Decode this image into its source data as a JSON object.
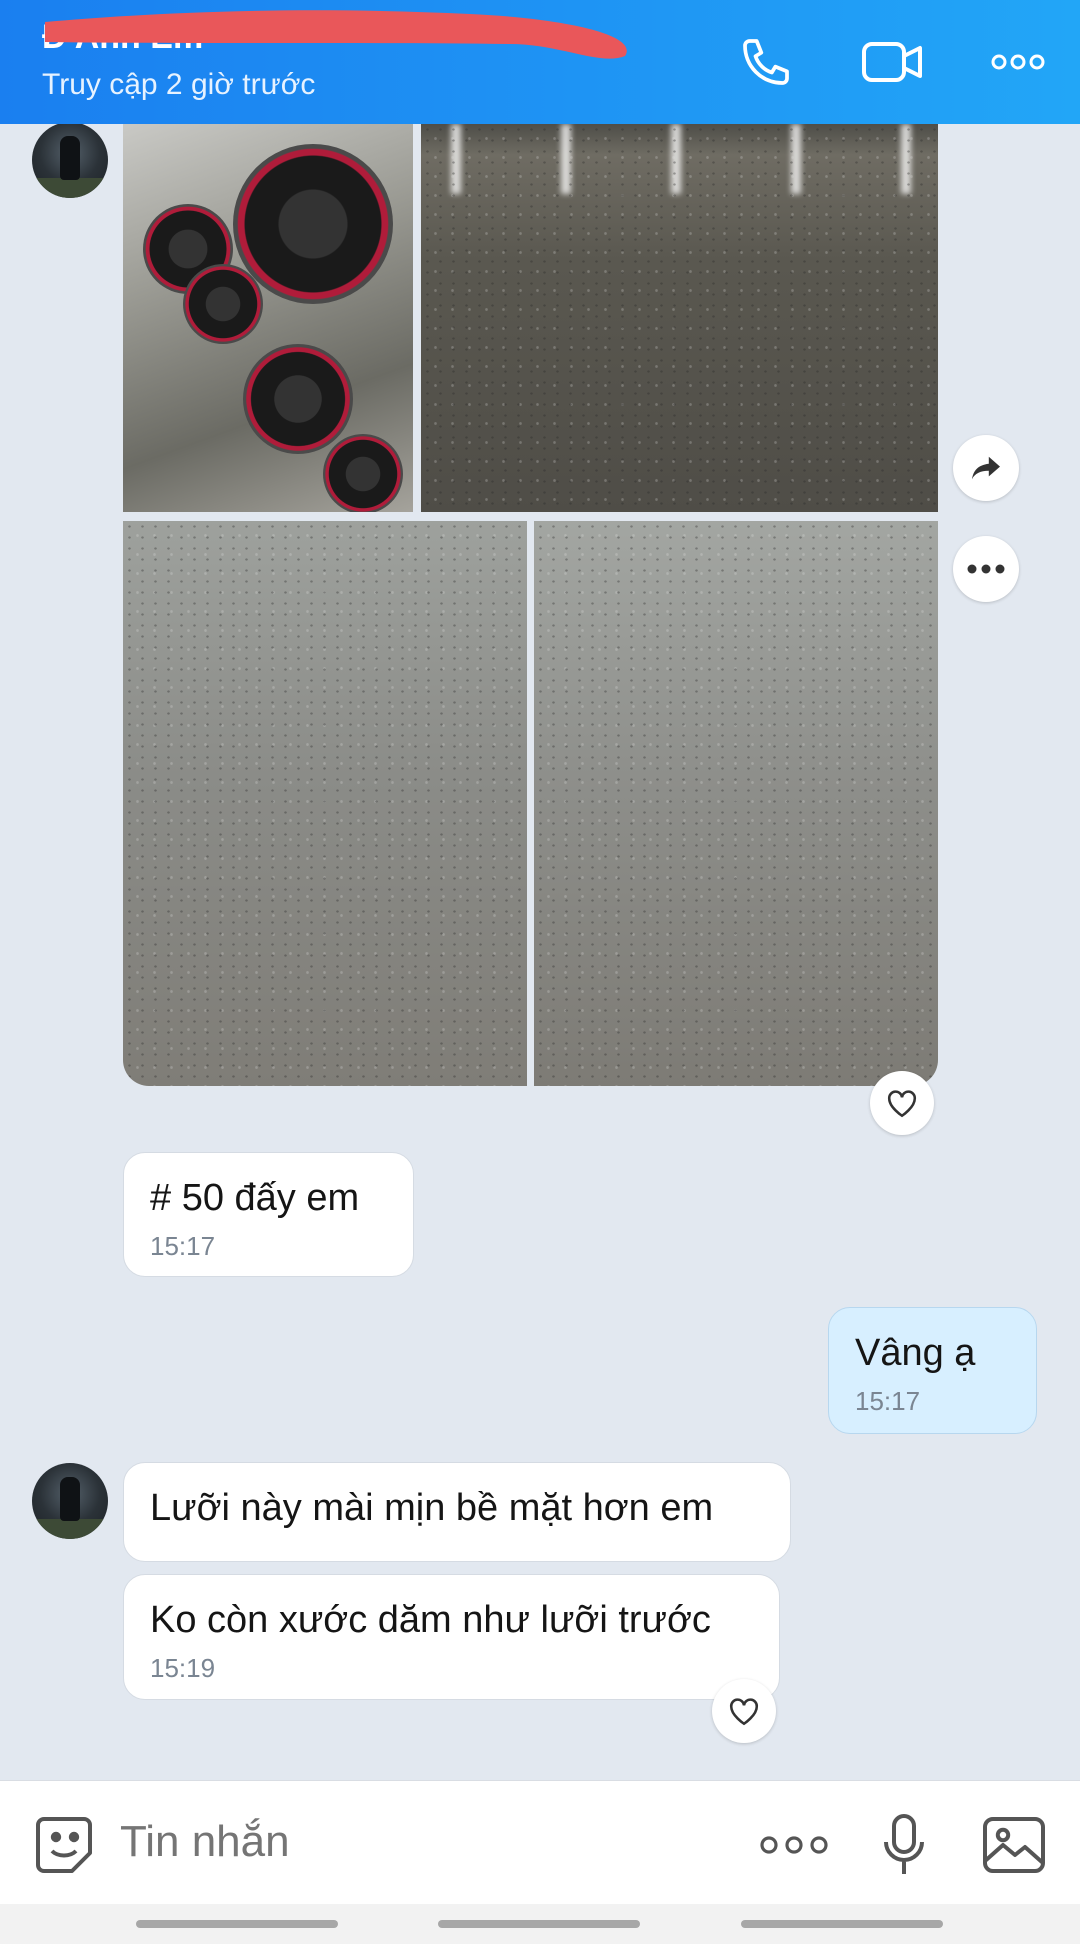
{
  "header": {
    "contact_name": "Đ Anh Em",
    "last_seen": "Truy cập 2 giờ trước",
    "icons": [
      "phone-icon",
      "video-call-icon",
      "more-icon"
    ]
  },
  "messages": [
    {
      "type": "album",
      "from": "contact",
      "photos": 4,
      "actions": [
        "share-icon",
        "more-icon",
        "heart-icon"
      ]
    },
    {
      "type": "text",
      "from": "contact",
      "text": "# 50 đấy em",
      "time": "15:17"
    },
    {
      "type": "text",
      "from": "me",
      "text": "Vâng ạ",
      "time": "15:17"
    },
    {
      "type": "text",
      "from": "contact",
      "text": "Lưỡi này mài mịn bề mặt hơn em"
    },
    {
      "type": "text",
      "from": "contact",
      "text": "Ko còn xước dăm như lưỡi trước",
      "time": "15:19"
    }
  ],
  "composer": {
    "placeholder": "Tin nhắn",
    "icons": [
      "sticker-icon",
      "more-icon",
      "microphone-icon",
      "image-icon"
    ]
  },
  "colors": {
    "header_start": "#1a7ff0",
    "header_end": "#22a6f7",
    "background": "#e2e8f0",
    "my_bubble": "#d7efff"
  }
}
